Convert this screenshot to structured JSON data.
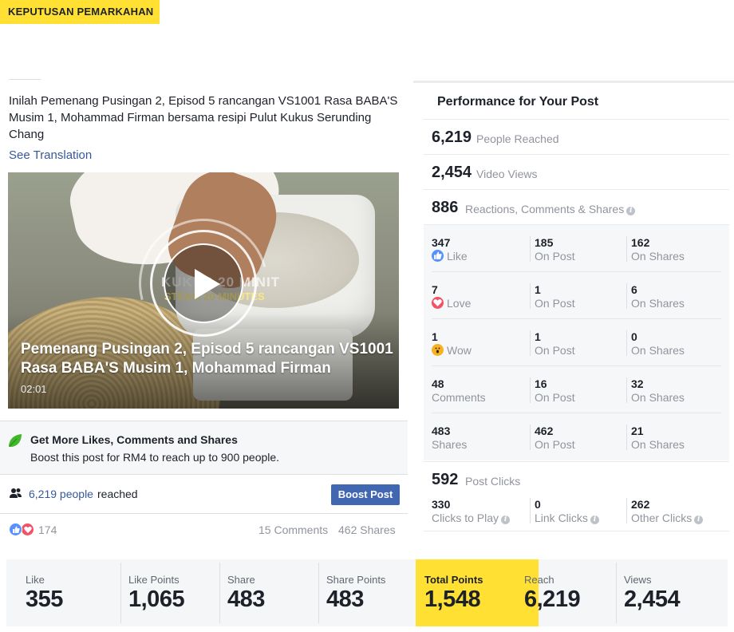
{
  "banner": {
    "label": "KEPUTUSAN PEMARKAHAN",
    "color": "#ffe033"
  },
  "post": {
    "text": "Inilah Pemenang Pusingan 2, Episod 5 rancangan VS1001 Rasa BABA'S Musim 1, Mohammad Firman bersama resipi Pulut Kukus Serunding Chang",
    "see_translation": "See Translation",
    "video": {
      "title": "Pemenang Pusingan 2, Episod 5 rancangan VS1001 Rasa BABA'S Musim 1, Mohammad Firman",
      "duration": "02:01",
      "watermark_line1": "KUKUS 20 MINIT",
      "watermark_line2": "STEAM 20 MINUTES",
      "play_icon": "play-icon"
    },
    "boost_promo": {
      "title": "Get More Likes, Comments and Shares",
      "subtitle": "Boost this post for RM4 to reach up to 900 people.",
      "icon": "leaf-icon"
    },
    "reach": {
      "link_text": "6,219 people",
      "suffix": "reached",
      "button": "Boost Post",
      "icon": "people-icon"
    },
    "reactions": {
      "count": "174",
      "comments": "15 Comments",
      "shares": "462 Shares"
    }
  },
  "performance": {
    "title": "Performance for Your Post",
    "people_reached": {
      "num": "6,219",
      "label": "People Reached"
    },
    "video_views": {
      "num": "2,454",
      "label": "Video Views"
    },
    "engagement": {
      "num": "886",
      "label": "Reactions, Comments & Shares"
    },
    "breakdown": [
      {
        "total": "347",
        "total_label": "Like",
        "icon": "like-icon",
        "on_post": "185",
        "on_post_label": "On Post",
        "on_shares": "162",
        "on_shares_label": "On Shares"
      },
      {
        "total": "7",
        "total_label": "Love",
        "icon": "love-icon",
        "on_post": "1",
        "on_post_label": "On Post",
        "on_shares": "6",
        "on_shares_label": "On Shares"
      },
      {
        "total": "1",
        "total_label": "Wow",
        "icon": "wow-icon",
        "on_post": "1",
        "on_post_label": "On Post",
        "on_shares": "0",
        "on_shares_label": "On Shares"
      },
      {
        "total": "48",
        "total_label": "Comments",
        "icon": "",
        "on_post": "16",
        "on_post_label": "On Post",
        "on_shares": "32",
        "on_shares_label": "On Shares"
      },
      {
        "total": "483",
        "total_label": "Shares",
        "icon": "",
        "on_post": "462",
        "on_post_label": "On Post",
        "on_shares": "21",
        "on_shares_label": "On Shares"
      }
    ],
    "post_clicks": {
      "num": "592",
      "label": "Post Clicks"
    },
    "clicks": [
      {
        "value": "330",
        "label": "Clicks to Play"
      },
      {
        "value": "0",
        "label": "Link Clicks"
      },
      {
        "value": "262",
        "label": "Other Clicks"
      }
    ]
  },
  "stats": [
    {
      "label": "Like",
      "value": "355"
    },
    {
      "label": "Like Points",
      "value": "1,065"
    },
    {
      "label": "Share",
      "value": "483"
    },
    {
      "label": "Share Points",
      "value": "483"
    },
    {
      "label": "Total Points",
      "value": "1,548",
      "highlight": true
    },
    {
      "label": "Reach",
      "value": "6,219"
    },
    {
      "label": "Views",
      "value": "2,454"
    }
  ],
  "colors": {
    "link": "#365899",
    "button": "#4267b2",
    "highlight": "#ffe033",
    "muted_text": "#90949c",
    "like_blue": "#5890ff",
    "love_red": "#f25268",
    "leaf_green": "#42b72a"
  }
}
